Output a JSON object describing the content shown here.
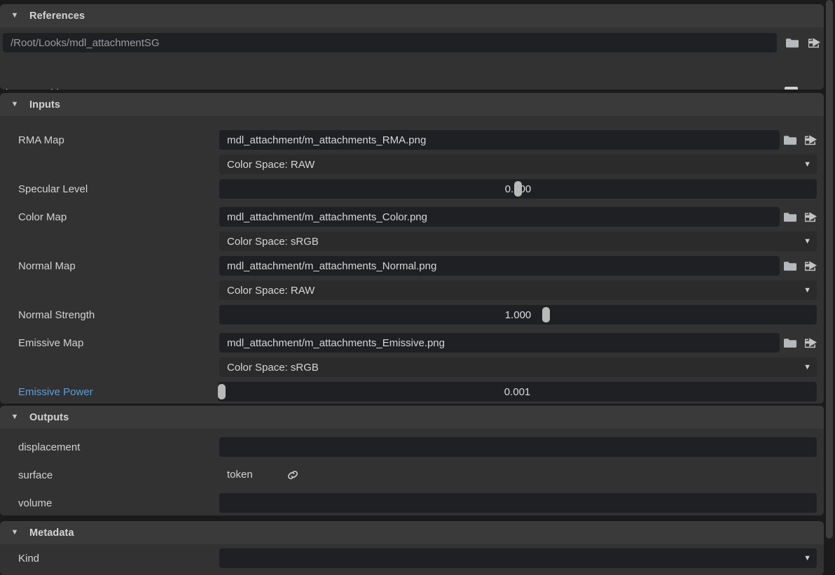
{
  "theme": {
    "window_bg": "#1b1b1b",
    "panel_bg": "#323232",
    "panel_header_bg": "#3a3a3a",
    "field_bg": "#1e2024",
    "dropdown_bg": "#2b2b2b",
    "text": "#d2d2d2",
    "accent": "#5f9ed6",
    "slider_handle": "#b9b9b9",
    "scrollbar_thumb": "#3e3e3e"
  },
  "sections": {
    "references": {
      "title": "References",
      "disclosure": "expanded",
      "path_field": {
        "value": "/Root/Looks/mdl_attachmentSG",
        "folder_icon": "folder-icon",
        "goto_icon": "external-link-icon"
      },
      "instanceable": {
        "label": "instanceable",
        "checked": true
      }
    },
    "inputs": {
      "title": "Inputs",
      "disclosure": "expanded",
      "rma_map": {
        "label": "RMA Map",
        "value": "mdl_attachment/m_attachments_RMA.png",
        "colorspace": "Color Space: RAW"
      },
      "specular_level": {
        "label": "Specular Level",
        "value": "0.500",
        "fraction": 0.5
      },
      "color_map": {
        "label": "Color Map",
        "value": "mdl_attachment/m_attachments_Color.png",
        "colorspace": "Color Space: sRGB"
      },
      "normal_map": {
        "label": "Normal Map",
        "value": "mdl_attachment/m_attachments_Normal.png",
        "colorspace": "Color Space: RAW"
      },
      "normal_strength": {
        "label": "Normal Strength",
        "value": "1.000",
        "fraction": 0.548
      },
      "emissive_map": {
        "label": "Emissive Map",
        "value": "mdl_attachment/m_attachments_Emissive.png",
        "colorspace": "Color Space: sRGB"
      },
      "emissive_power": {
        "label": "Emissive Power",
        "value": "0.001",
        "fraction": 0.0,
        "highlighted": true
      }
    },
    "outputs": {
      "title": "Outputs",
      "disclosure": "expanded",
      "displacement": {
        "label": "displacement",
        "value": ""
      },
      "surface": {
        "label": "surface",
        "value": "token",
        "link_icon": "link-icon"
      },
      "volume": {
        "label": "volume",
        "value": ""
      }
    },
    "metadata": {
      "title": "Metadata",
      "disclosure": "expanded",
      "kind": {
        "label": "Kind",
        "value": ""
      }
    }
  },
  "icons": {
    "disclosure_glyph": "▼",
    "caret_glyph": "▼"
  },
  "scrollbar": {
    "position": "top"
  }
}
